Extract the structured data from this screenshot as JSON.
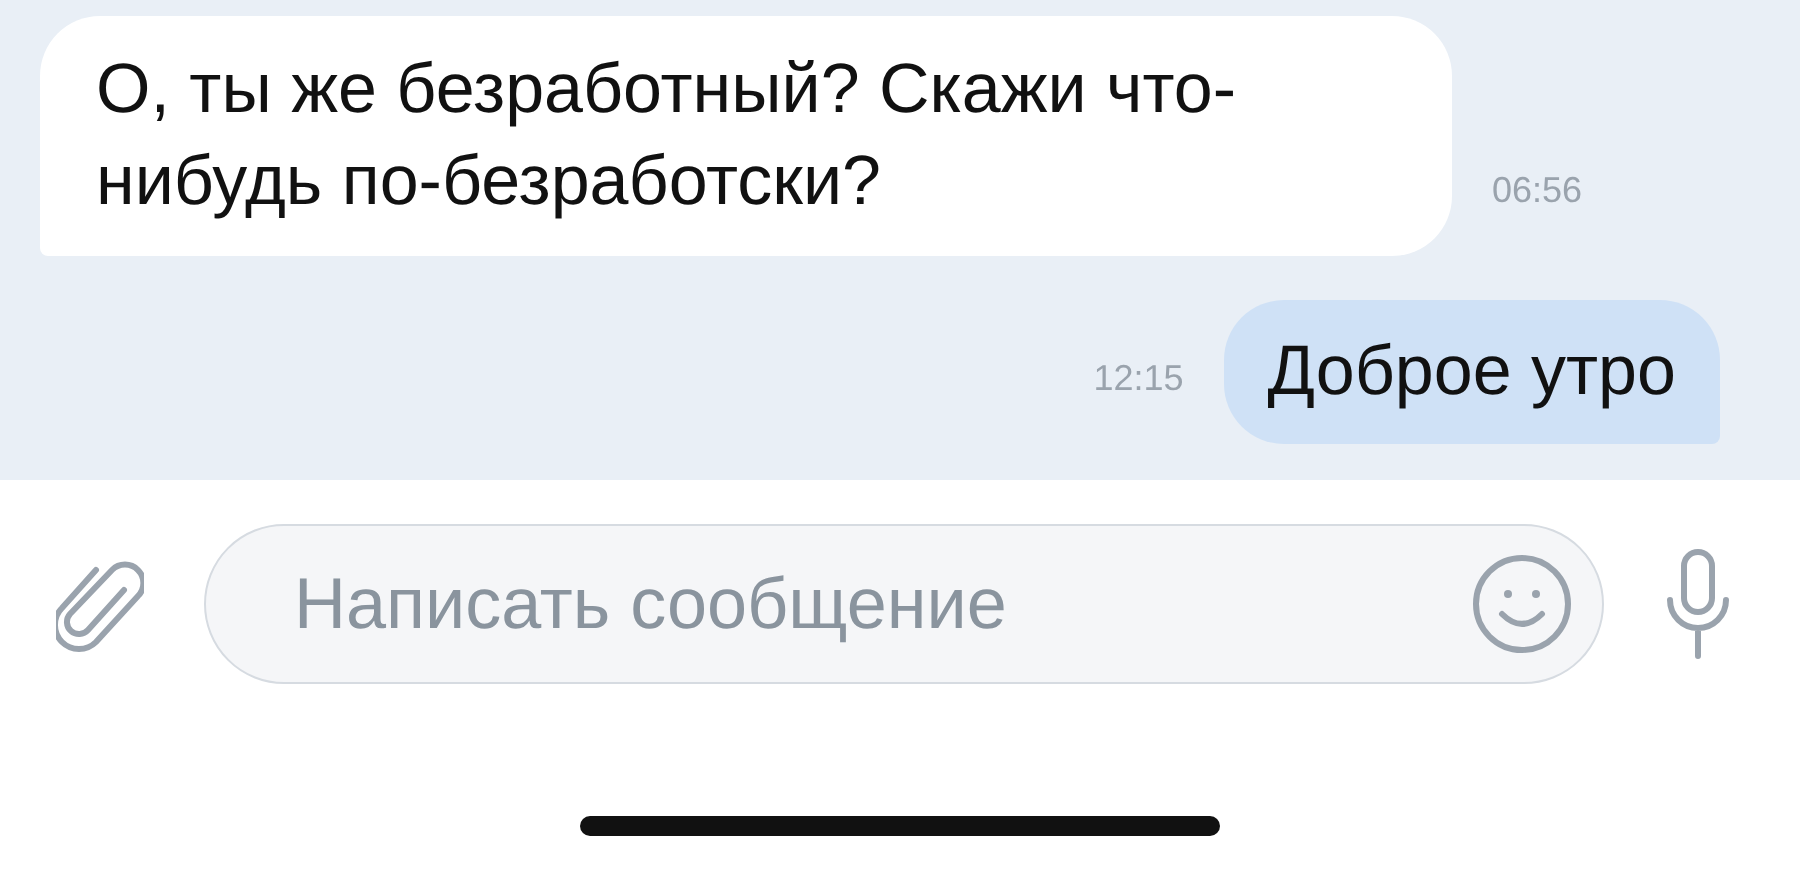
{
  "messages": [
    {
      "kind": "incoming",
      "text": "О, ты же безработный? Скажи что-нибудь по-безработски?",
      "time": "06:56"
    },
    {
      "kind": "outgoing",
      "text": "Доброе утро",
      "time": "12:15"
    }
  ],
  "composer": {
    "placeholder": "Написать сообщение"
  }
}
